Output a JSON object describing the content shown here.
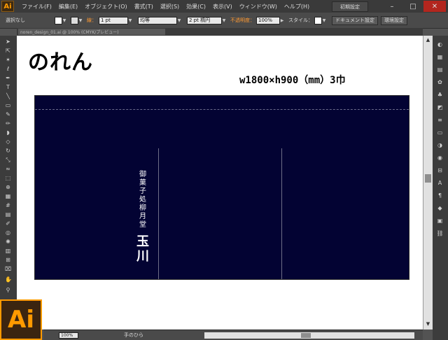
{
  "app": {
    "logo_small": "Ai",
    "logo_large": "Ai",
    "menus": [
      "ファイル(F)",
      "編集(E)",
      "オブジェクト(O)",
      "書式(T)",
      "選択(S)",
      "効果(C)",
      "表示(V)",
      "ウィンドウ(W)",
      "ヘルプ(H)"
    ],
    "workspace": "初期設定",
    "window_controls": {
      "minimize": "–",
      "maximize": "□",
      "close": "✕"
    }
  },
  "control_bar": {
    "selection": "選択なし",
    "stroke_label": "線：",
    "stroke_weight": "1 pt",
    "profile": "均等",
    "brush": "2 pt 楕円",
    "opacity_label": "不透明度：",
    "opacity": "100%",
    "style_label": "スタイル：",
    "doc_setup_button": "ドキュメント設定",
    "prefs_button": "環境設定"
  },
  "document": {
    "tab_title": "noren_design_01.ai @ 100% (CMYK/プレビュー)",
    "title": "のれん",
    "dimensions": "w1800×h900（mm）3巾",
    "shop_text_small": "御菓子処柳月堂",
    "shop_text_large": "玉川",
    "noren_color": "#030333"
  },
  "status_bar": {
    "zoom": "100%",
    "current_tool": "手のひら"
  },
  "colors": {
    "accent": "#ff9a00",
    "chrome_dark": "#3c3c3c",
    "chrome_mid": "#4a4a4a"
  }
}
